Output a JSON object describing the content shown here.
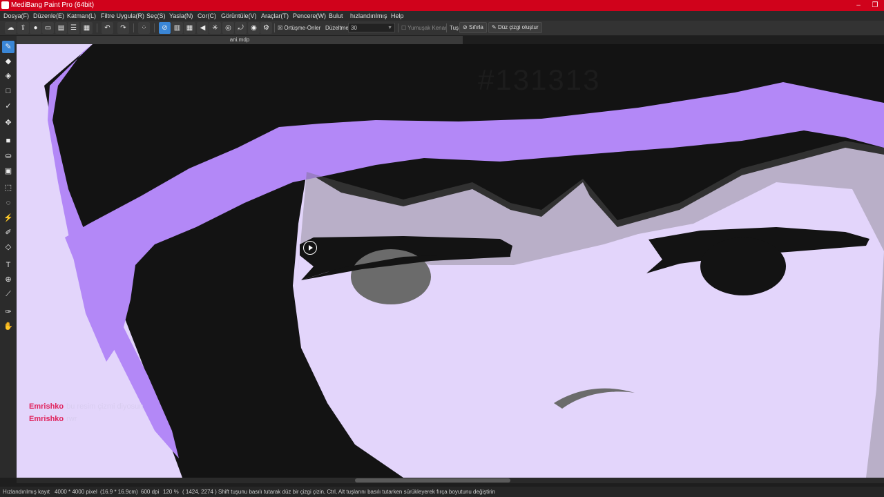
{
  "window": {
    "title": "MediBang Paint Pro (64bit)"
  },
  "menu": [
    "Dosya(F)",
    "Düzenle(E)",
    "Katman(L)",
    "Filtre Uygula(R)",
    "Seç(S)",
    "Yasla(N)",
    "Cor(C)",
    "Görüntüle(V)",
    "Araçlar(T)",
    "Pencere(W)",
    "Bulut",
    "hızlandırılmış",
    "Help"
  ],
  "toolbar": {
    "overlap_label": "Örtüşme-Önler",
    "smoothing_label": "Düzeltme",
    "smoothing_value": "30",
    "soft_edge_label": "Yumuşak Kenar",
    "tus_label": "Tuş",
    "reset_label": "Sıfırla",
    "line_label": "Düz çizgi oluştur"
  },
  "tab": {
    "filename": "ani.mdp"
  },
  "canvas": {
    "color_note": "#131313",
    "colors": {
      "hair": "#131313",
      "highlight": "#b388f7",
      "skin": "#e3d5fb",
      "shadow": "#6b6b6b"
    }
  },
  "chat": [
    {
      "user": "Emrishko",
      "message": "bu resim çizmi diyosun"
    },
    {
      "user": "Emrishko",
      "message": "rwr"
    }
  ],
  "status": {
    "mode": "Hızlandırılmış kayıt",
    "size": "4000 * 4000 pixel",
    "cm": "(16.9 * 16.9cm)",
    "dpi": "600 dpi",
    "zoom": "120 %",
    "coords": "( 1424, 2274 )",
    "hint": "Shift tuşunu basılı tutarak düz bir çizgi çizin, Ctrl, Alt tuşlarını basılı tutarken sürükleyerek fırça boyutunu değiştirin"
  },
  "icons": {
    "left_tools": [
      "brush-icon",
      "eraser-icon",
      "dot-eraser-icon",
      "shape-icon",
      "pen-icon",
      "move-icon",
      "fill-rect-icon",
      "bucket-icon",
      "gradient-icon",
      "select-icon",
      "lasso-icon",
      "magic-wand-icon",
      "select-pen-icon",
      "select-eraser-icon",
      "text-icon",
      "divide-icon",
      "eyedropper-icon",
      "dropper-icon",
      "hand-icon"
    ]
  }
}
